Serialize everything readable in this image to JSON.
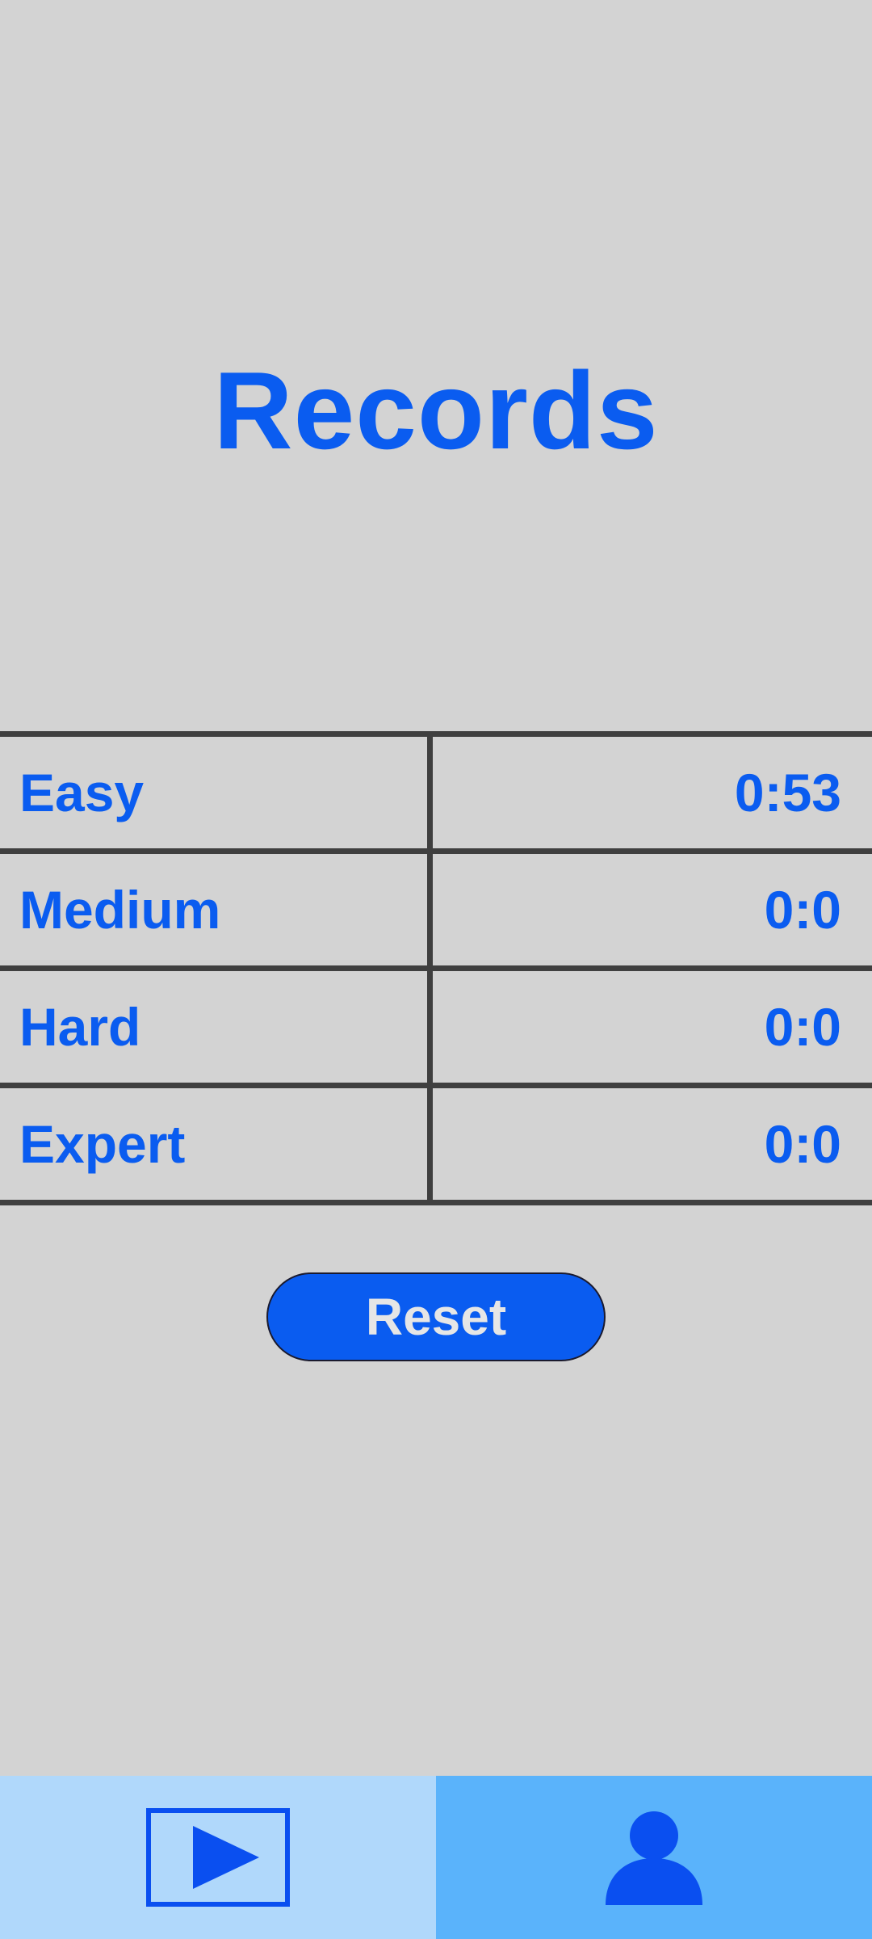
{
  "page": {
    "title": "Records"
  },
  "records": {
    "rows": [
      {
        "label": "Easy",
        "value": "0:53"
      },
      {
        "label": "Medium",
        "value": "0:0"
      },
      {
        "label": "Hard",
        "value": "0:0"
      },
      {
        "label": "Expert",
        "value": "0:0"
      }
    ]
  },
  "actions": {
    "reset_label": "Reset"
  },
  "bottom_nav": {
    "tabs": [
      {
        "icon": "play-icon",
        "active": false
      },
      {
        "icon": "person-icon",
        "active": true
      }
    ]
  },
  "colors": {
    "accent": "#0a5cf0",
    "background": "#d3d3d3",
    "nav_inactive": "#b0d8fb",
    "nav_active": "#5ab3fb",
    "divider": "#3f3f3f"
  }
}
